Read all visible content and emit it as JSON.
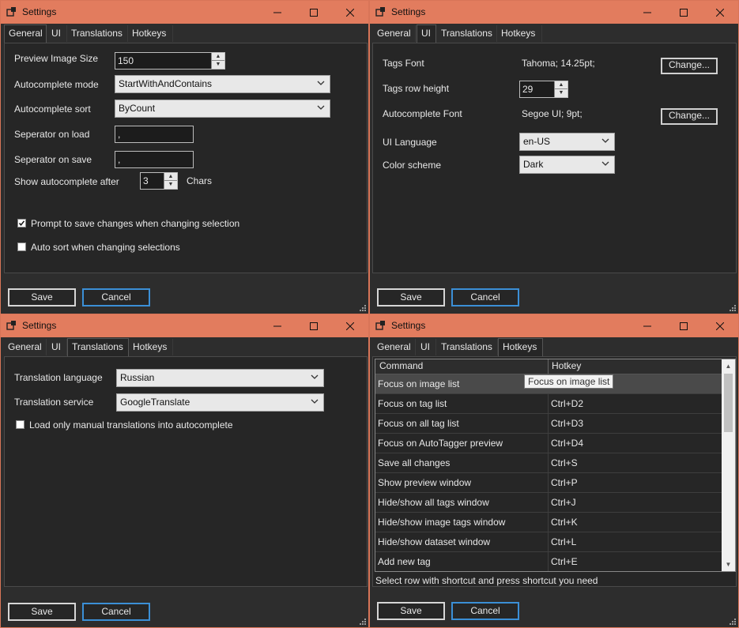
{
  "window_title": "Settings",
  "tabs": [
    "General",
    "UI",
    "Translations",
    "Hotkeys"
  ],
  "buttons": {
    "save": "Save",
    "cancel": "Cancel",
    "change": "Change..."
  },
  "general": {
    "preview_image_size": {
      "label": "Preview Image Size",
      "value": "150"
    },
    "autocomplete_mode": {
      "label": "Autocomplete mode",
      "value": "StartWithAndContains"
    },
    "autocomplete_sort": {
      "label": "Autocomplete sort",
      "value": "ByCount"
    },
    "separator_on_load": {
      "label": "Seperator on load",
      "value": ","
    },
    "separator_on_save": {
      "label": "Seperator on save",
      "value": ","
    },
    "show_autocomplete_after": {
      "label": "Show autocomplete after",
      "value": "3",
      "suffix": "Chars"
    },
    "prompt_to_save": {
      "label": "Prompt to save changes when changing selection",
      "checked": true
    },
    "auto_sort": {
      "label": "Auto sort when changing selections",
      "checked": false
    }
  },
  "ui": {
    "tags_font": {
      "label": "Tags Font",
      "value": "Tahoma; 14.25pt;"
    },
    "tags_row_height": {
      "label": "Tags row height",
      "value": "29"
    },
    "autocomplete_font": {
      "label": "Autocomplete Font",
      "value": "Segoe UI; 9pt;"
    },
    "ui_language": {
      "label": "UI Language",
      "value": "en-US"
    },
    "color_scheme": {
      "label": "Color scheme",
      "value": "Dark"
    }
  },
  "translations": {
    "translation_language": {
      "label": "Translation language",
      "value": "Russian"
    },
    "translation_service": {
      "label": "Translation service",
      "value": "GoogleTranslate"
    },
    "manual_only": {
      "label": "Load only manual translations into autocomplete",
      "checked": false
    }
  },
  "hotkeys": {
    "columns": [
      "Command",
      "Hotkey"
    ],
    "rows": [
      {
        "command": "Focus on image list",
        "hotkey": ""
      },
      {
        "command": "Focus on tag list",
        "hotkey": "Ctrl+D2"
      },
      {
        "command": "Focus on all tag list",
        "hotkey": "Ctrl+D3"
      },
      {
        "command": "Focus on AutoTagger preview",
        "hotkey": "Ctrl+D4"
      },
      {
        "command": "Save all changes",
        "hotkey": "Ctrl+S"
      },
      {
        "command": "Show preview window",
        "hotkey": "Ctrl+P"
      },
      {
        "command": "Hide/show all tags window",
        "hotkey": "Ctrl+J"
      },
      {
        "command": "Hide/show image tags window",
        "hotkey": "Ctrl+K"
      },
      {
        "command": "Hide/show dataset window",
        "hotkey": "Ctrl+L"
      },
      {
        "command": "Add new tag",
        "hotkey": "Ctrl+E"
      }
    ],
    "tooltip": "Focus on image list",
    "hint": "Select row with shortcut and press shortcut you need"
  },
  "colors": {
    "titlebar": "#e27c5e",
    "window_bg": "#2d2d2d",
    "panel_bg": "#262626",
    "accent": "#3b8fd6"
  }
}
